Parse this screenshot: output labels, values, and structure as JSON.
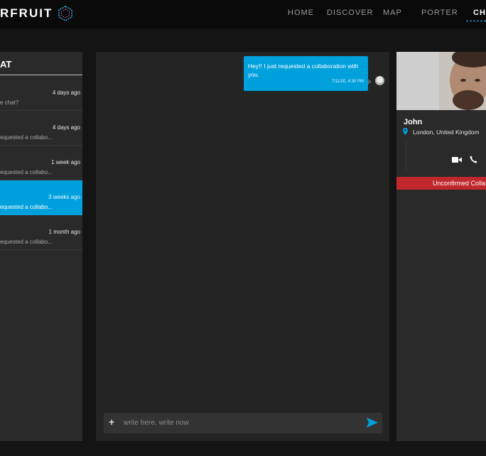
{
  "brand": {
    "logo_text": "RFRUIT"
  },
  "nav": {
    "items": [
      {
        "label": "HOME",
        "active": false
      },
      {
        "label": "DISCOVER",
        "active": false
      },
      {
        "label": "MAP",
        "active": false
      },
      {
        "label": "PORTER",
        "active": false
      },
      {
        "label": "CHA",
        "active": true
      }
    ]
  },
  "conversations": {
    "title": "AT",
    "items": [
      {
        "time": "4 days ago",
        "preview": "e chat?",
        "active": false
      },
      {
        "time": "4 days ago",
        "preview": "equested a collabo...",
        "active": false
      },
      {
        "time": "1 week ago",
        "preview": "equested a collabo...",
        "active": false
      },
      {
        "time": "3 weeks ago",
        "preview": "equested a collabo...",
        "active": true
      },
      {
        "time": "1 month ago",
        "preview": "equested a collabo...",
        "active": false
      }
    ]
  },
  "chat": {
    "messages": [
      {
        "text": "Hey!! I just requested a collaboration with you.",
        "time": "7/11/20, 4:30 PM"
      }
    ],
    "composer": {
      "placeholder": "write here, write now"
    }
  },
  "profile": {
    "name": "John",
    "location": "London, United Kingdom",
    "status": "Unconfirmed Colla"
  },
  "colors": {
    "accent": "#00a0dc",
    "status_red": "#c0282d",
    "background": "#141414",
    "panel": "#2a2a2a"
  },
  "icons": [
    "hexagon-logo-icon",
    "plus-icon",
    "send-icon",
    "location-pin-icon",
    "video-camera-icon",
    "phone-icon"
  ]
}
